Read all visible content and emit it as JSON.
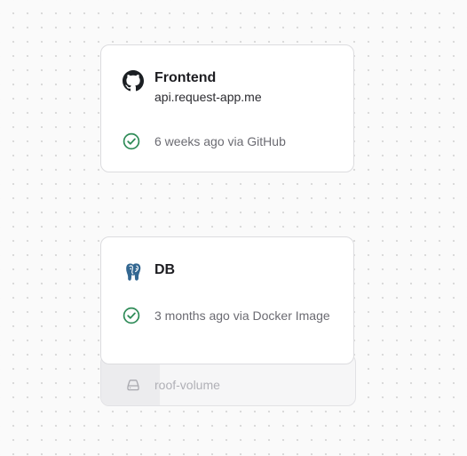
{
  "services": [
    {
      "name": "Frontend",
      "domain": "api.request-app.me",
      "status": "6 weeks ago via GitHub",
      "icon": "github-icon",
      "status_icon": "check-circle-icon"
    },
    {
      "name": "DB",
      "status": "3 months ago via Docker Image",
      "icon": "postgresql-icon",
      "status_icon": "check-circle-icon"
    }
  ],
  "volume": {
    "label": "roof-volume",
    "icon": "hard-drive-icon"
  },
  "colors": {
    "success": "#2e8b57",
    "postgres_blue": "#336791",
    "canvas_background": "#fafafa",
    "card_background": "#ffffff"
  }
}
